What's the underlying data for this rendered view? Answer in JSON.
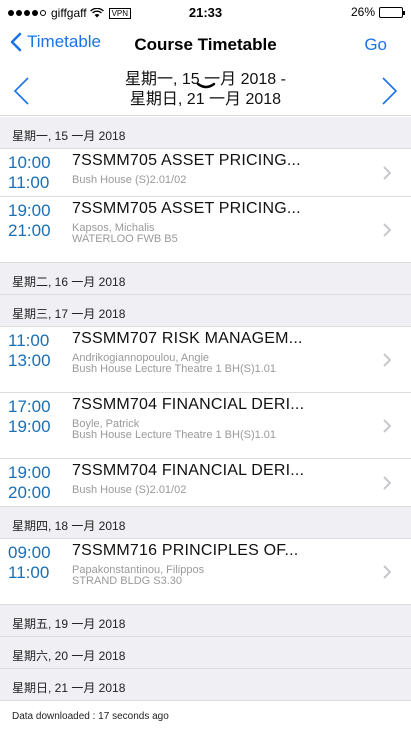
{
  "status_bar": {
    "carrier": "giffgaff",
    "vpn": "VPN",
    "time": "21:33",
    "battery": "26%",
    "battery_level": 0.26,
    "battery_color": "#f2c400"
  },
  "nav": {
    "back_label": "Timetable",
    "title": "Course Timetable",
    "go_label": "Go"
  },
  "date_range": {
    "line1": "星期一, 15 一月 2018 -",
    "line2": "星期日, 21 一月 2018"
  },
  "days": [
    {
      "header": "星期一, 15 一月 2018",
      "events": [
        {
          "start": "10:00",
          "end": "11:00",
          "title": "7SSMM705 ASSET PRICING...",
          "lines": [
            "Bush House (S)2.01/02"
          ]
        },
        {
          "start": "19:00",
          "end": "21:00",
          "title": "7SSMM705 ASSET PRICING...",
          "lines": [
            "Kapsos, Michalis",
            "WATERLOO FWB B5"
          ]
        }
      ]
    },
    {
      "header": "星期二, 16 一月 2018",
      "events": []
    },
    {
      "header": "星期三, 17 一月 2018",
      "events": [
        {
          "start": "11:00",
          "end": "13:00",
          "title": "7SSMM707 RISK MANAGEM...",
          "lines": [
            "Andrikogiannopoulou, Angie",
            "Bush House Lecture Theatre 1 BH(S)1.01"
          ]
        },
        {
          "start": "17:00",
          "end": "19:00",
          "title": "7SSMM704 FINANCIAL DERI...",
          "lines": [
            "Boyle, Patrick",
            "Bush House Lecture Theatre 1 BH(S)1.01"
          ]
        },
        {
          "start": "19:00",
          "end": "20:00",
          "title": "7SSMM704 FINANCIAL DERI...",
          "lines": [
            "Bush House (S)2.01/02"
          ]
        }
      ]
    },
    {
      "header": "星期四, 18 一月 2018",
      "events": [
        {
          "start": "09:00",
          "end": "11:00",
          "title": "7SSMM716 PRINCIPLES OF...",
          "lines": [
            "Papakonstantinou, Filippos",
            "STRAND BLDG S3.30"
          ]
        }
      ]
    },
    {
      "header": "星期五, 19 一月 2018",
      "events": []
    },
    {
      "header": "星期六, 20 一月 2018",
      "events": []
    },
    {
      "header": "星期日, 21 一月 2018",
      "events": []
    }
  ],
  "footer": {
    "text": "Data downloaded : 17 seconds ago"
  },
  "colors": {
    "accent": "#1a73e8",
    "time": "#1a6fb5",
    "header_bg": "#efeff4"
  }
}
